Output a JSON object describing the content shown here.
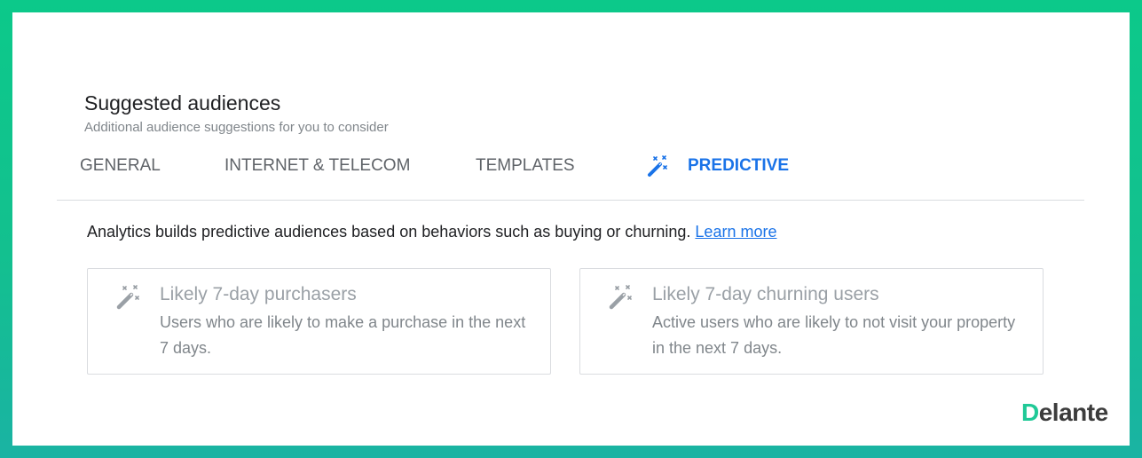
{
  "header": {
    "title": "Suggested audiences",
    "subtitle": "Additional audience suggestions for you to consider"
  },
  "tabs": [
    {
      "label": "GENERAL",
      "active": false
    },
    {
      "label": "INTERNET & TELECOM",
      "active": false
    },
    {
      "label": "TEMPLATES",
      "active": false
    },
    {
      "label": "PREDICTIVE",
      "active": true,
      "icon": "magic-wand-icon"
    }
  ],
  "info": {
    "text": "Analytics builds predictive audiences based on behaviors such as buying or churning.",
    "link_label": "Learn more"
  },
  "cards": [
    {
      "icon": "magic-wand-icon",
      "title": "Likely 7-day purchasers",
      "description": "Users who are likely to make a purchase in the next 7 days."
    },
    {
      "icon": "magic-wand-icon",
      "title": "Likely 7-day churning users",
      "description": "Active users who are likely to not visit your property in the next 7 days."
    }
  ],
  "brand": {
    "initial": "D",
    "rest": "elante"
  },
  "colors": {
    "accent": "#1a73e8",
    "frame_top": "#0cc98a",
    "frame_bottom": "#1ab3a3",
    "brand_mark": "#20c997"
  }
}
